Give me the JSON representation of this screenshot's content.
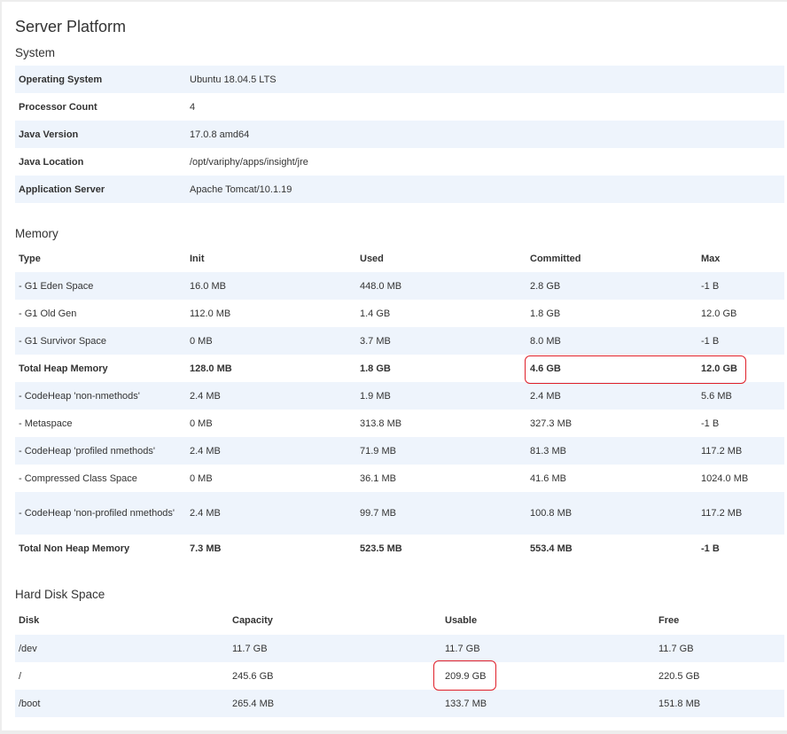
{
  "title": "Server Platform",
  "system": {
    "heading": "System",
    "rows": [
      {
        "label": "Operating System",
        "value": "Ubuntu 18.04.5 LTS"
      },
      {
        "label": "Processor Count",
        "value": "4"
      },
      {
        "label": "Java Version",
        "value": "17.0.8 amd64"
      },
      {
        "label": "Java Location",
        "value": "/opt/variphy/apps/insight/jre"
      },
      {
        "label": "Application Server",
        "value": "Apache Tomcat/10.1.19"
      }
    ]
  },
  "memory": {
    "heading": "Memory",
    "columns": [
      "Type",
      "Init",
      "Used",
      "Committed",
      "Max"
    ],
    "rows": [
      [
        "- G1 Eden Space",
        "16.0 MB",
        "448.0 MB",
        "2.8 GB",
        "-1 B"
      ],
      [
        "- G1 Old Gen",
        "112.0 MB",
        "1.4 GB",
        "1.8 GB",
        "12.0 GB"
      ],
      [
        "- G1 Survivor Space",
        "0 MB",
        "3.7 MB",
        "8.0 MB",
        "-1 B"
      ],
      [
        "Total Heap Memory",
        "128.0 MB",
        "1.8 GB",
        "4.6 GB",
        "12.0 GB"
      ],
      [
        "- CodeHeap 'non-nmethods'",
        "2.4 MB",
        "1.9 MB",
        "2.4 MB",
        "5.6 MB"
      ],
      [
        "- Metaspace",
        "0 MB",
        "313.8 MB",
        "327.3 MB",
        "-1 B"
      ],
      [
        "- CodeHeap 'profiled nmethods'",
        "2.4 MB",
        "71.9 MB",
        "81.3 MB",
        "117.2 MB"
      ],
      [
        "- Compressed Class Space",
        "0 MB",
        "36.1 MB",
        "41.6 MB",
        "1024.0 MB"
      ],
      [
        "- CodeHeap 'non-profiled nmethods'",
        "2.4 MB",
        "99.7 MB",
        "100.8 MB",
        "117.2 MB"
      ],
      [
        "Total Non Heap Memory",
        "7.3 MB",
        "523.5 MB",
        "553.4 MB",
        "-1 B"
      ]
    ]
  },
  "disk": {
    "heading": "Hard Disk Space",
    "columns": [
      "Disk",
      "Capacity",
      "Usable",
      "Free"
    ],
    "rows": [
      [
        "/dev",
        "11.7 GB",
        "11.7 GB",
        "11.7 GB"
      ],
      [
        "/",
        "245.6 GB",
        "209.9 GB",
        "220.5 GB"
      ],
      [
        "/boot",
        "265.4 MB",
        "133.7 MB",
        "151.8 MB"
      ]
    ]
  },
  "colors": {
    "stripe": "#eef4fc",
    "highlight": "#e0202a"
  }
}
